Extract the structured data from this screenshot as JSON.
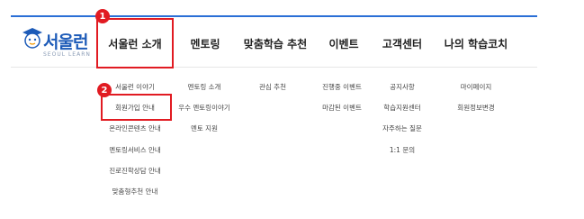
{
  "logo": {
    "name": "서울런",
    "sub": "SEOUL LEARN"
  },
  "nav": [
    {
      "label": "서울런 소개",
      "items": [
        "서울런 이야기",
        "회원가입 안내",
        "온라인콘텐츠 안내",
        "멘토링서비스 안내",
        "진로진학상담 안내",
        "맞춤형추천 안내"
      ]
    },
    {
      "label": "멘토링",
      "items": [
        "멘토링 소개",
        "우수 멘토링이야기",
        "멘토 지원"
      ]
    },
    {
      "label": "맞춤학습 추천",
      "items": [
        "관심 추천"
      ]
    },
    {
      "label": "이벤트",
      "items": [
        "진행중 이벤트",
        "마감된 이벤트"
      ]
    },
    {
      "label": "고객센터",
      "items": [
        "공지사항",
        "학습지원센터",
        "자주하는 질문",
        "1:1 문의"
      ]
    },
    {
      "label": "나의 학습코치",
      "items": [
        "마이페이지",
        "회원정보변경"
      ]
    }
  ],
  "annotations": [
    "1",
    "2"
  ],
  "colors": {
    "accent": "#2a6fd6",
    "highlight": "#e11b22"
  }
}
